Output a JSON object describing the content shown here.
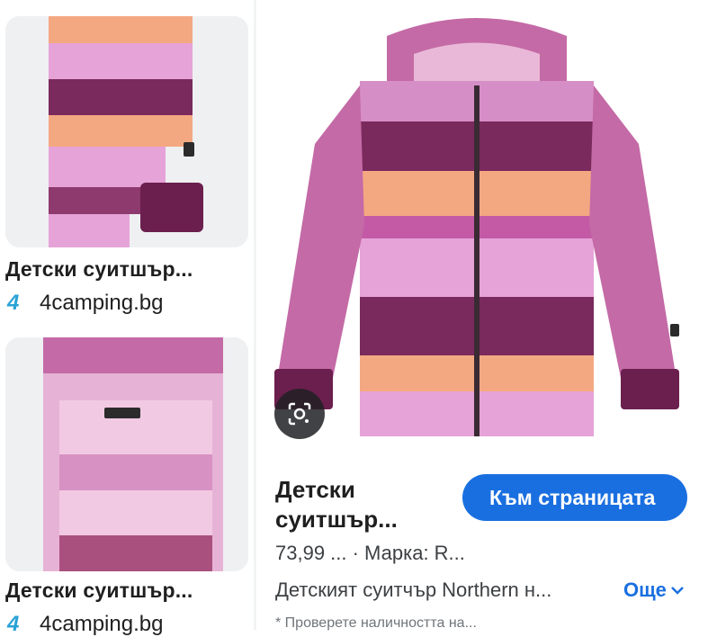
{
  "results": [
    {
      "caption": "Детски суитшър...",
      "source_name": "4camping.bg",
      "source_icon": "4camping-logo-icon"
    },
    {
      "caption": "Детски суитшър...",
      "source_name": "4camping.bg",
      "source_icon": "4camping-logo-icon"
    }
  ],
  "detail": {
    "title": "Детски суитшър...",
    "cta_label": "Към страницата",
    "price_line": "73,99 ... · Марка: R...",
    "description": "Детският суитчър Northern н...",
    "more_label": "Още",
    "disclaimer": "* Проверете наличността на..."
  },
  "colors": {
    "accent": "#1a6fe0",
    "plum": "#6b1f4e",
    "pink": "#e6a3d8",
    "peach": "#f4a882"
  },
  "icons": {
    "lens": "google-lens-icon",
    "chevron": "chevron-down-icon"
  }
}
